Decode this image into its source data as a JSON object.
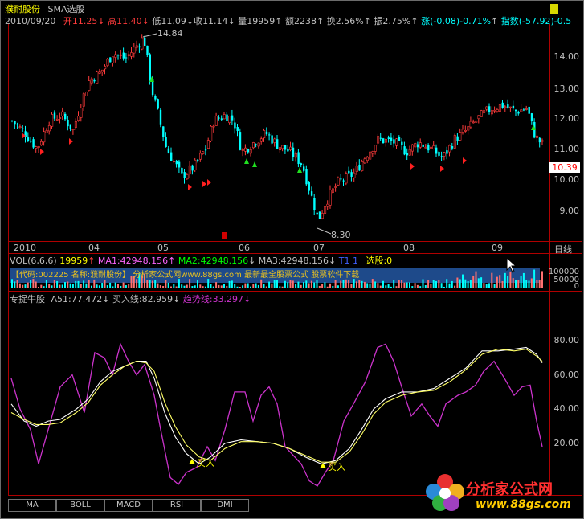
{
  "header": {
    "stock_name": "濮耐股份",
    "indicator_name": "SMA选股",
    "date": "2010/09/20",
    "open_label": "开",
    "open_value": "11.25",
    "high_label": "高",
    "high_value": "11.40",
    "low_label": "低",
    "low_value": "11.09",
    "close_label": "收",
    "close_value": "11.14",
    "volume_label": "量",
    "volume_value": "19959",
    "amount_label": "额",
    "amount_value": "2238",
    "turnover_label": "换",
    "turnover_value": "2.56%",
    "amplitude_label": "振",
    "amplitude_value": "2.75%",
    "change_label": "涨",
    "change_value": "(-0.08)-0.71%",
    "index_label": "指数",
    "index_value": "(-57.92)-0.5"
  },
  "price_chart": {
    "y_ticks": [
      "14.00",
      "12.00",
      "11.00",
      "10.00",
      "9.00"
    ],
    "tick_1300": "13.00",
    "current_price": "10.39",
    "high_annotation": "14.84",
    "low_annotation": "8.30",
    "x_labels": [
      "2010",
      "04",
      "05",
      "06",
      "07",
      "08",
      "09"
    ],
    "period_label": "日线"
  },
  "volume_panel": {
    "title": "VOL(6,6,6)",
    "vol_value": "19959",
    "ma1": "MA1:42948.156",
    "ma2": "MA2:42948.156",
    "ma3": "MA3:42948.156",
    "t_label": "T1",
    "t_value": "1",
    "select_label": "选股:0",
    "y_ticks": [
      "100000",
      "50000",
      "0"
    ],
    "banner_text": "【代码:002225  名称:濮耐股份】     分析家公式网www.88gs.com  最新最全股票公式  股票软件下载"
  },
  "indicator_panel": {
    "name": "专捉牛股",
    "a51": "A51:77.472",
    "buy_line": "买入线:82.959",
    "trend_line": "趋势线:33.297",
    "y_ticks": [
      "80.00",
      "60.00",
      "40.00",
      "20.00"
    ],
    "buy_signal_1": "买入",
    "buy_signal_2": "买入"
  },
  "tabs": [
    "MA",
    "BOLL",
    "MACD",
    "RSI",
    "DMI"
  ],
  "watermark": {
    "title": "分析家公式网",
    "url": "www.88gs.com"
  },
  "colors": {
    "up": "#ff3b3b",
    "down": "#00ffff",
    "yellow": "#ffff00",
    "magenta": "#cc33cc",
    "grid": "#b00000"
  }
}
